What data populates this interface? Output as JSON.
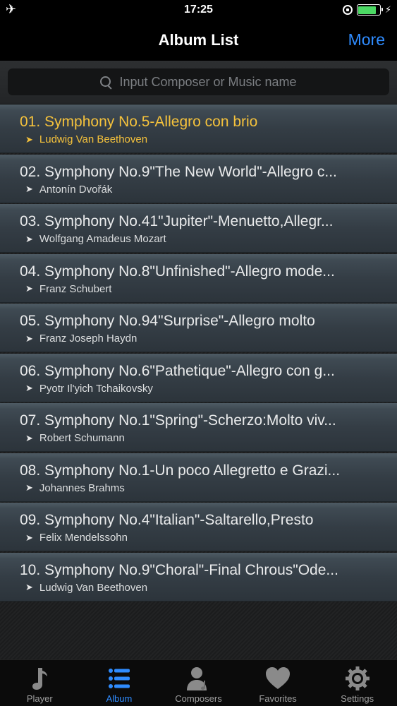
{
  "status_bar": {
    "time": "17:25",
    "battery_level": 0.85
  },
  "nav": {
    "title": "Album List",
    "more_label": "More"
  },
  "search": {
    "placeholder": "Input Composer or Music name"
  },
  "colors": {
    "accent": "#2f8cff",
    "active_row": "#f5c23c"
  },
  "list": {
    "active_index": 0,
    "items": [
      {
        "title": "01. Symphony No.5-Allegro con brio",
        "composer": "Ludwig Van Beethoven"
      },
      {
        "title": "02. Symphony No.9\"The New World\"-Allegro c...",
        "composer": "Antonín Dvořák"
      },
      {
        "title": "03. Symphony No.41\"Jupiter\"-Menuetto,Allegr...",
        "composer": "Wolfgang Amadeus Mozart"
      },
      {
        "title": "04. Symphony No.8\"Unfinished\"-Allegro mode...",
        "composer": "Franz Schubert"
      },
      {
        "title": "05. Symphony No.94\"Surprise\"-Allegro molto",
        "composer": "Franz Joseph Haydn"
      },
      {
        "title": "06. Symphony No.6\"Pathetique\"-Allegro con g...",
        "composer": "Pyotr Il'yich Tchaikovsky"
      },
      {
        "title": "07. Symphony No.1\"Spring\"-Scherzo:Molto viv...",
        "composer": "Robert Schumann"
      },
      {
        "title": "08. Symphony No.1-Un poco Allegretto e Grazi...",
        "composer": "Johannes Brahms"
      },
      {
        "title": "09. Symphony No.4\"Italian\"-Saltarello,Presto",
        "composer": "Felix Mendelssohn"
      },
      {
        "title": "10. Symphony No.9\"Choral\"-Final Chrous\"Ode...",
        "composer": "Ludwig Van Beethoven"
      }
    ]
  },
  "tabs": [
    {
      "label": "Player",
      "icon": "music-note-icon"
    },
    {
      "label": "Album",
      "icon": "list-icon"
    },
    {
      "label": "Composers",
      "icon": "composer-icon"
    },
    {
      "label": "Favorites",
      "icon": "heart-icon"
    },
    {
      "label": "Settings",
      "icon": "gear-icon"
    }
  ],
  "active_tab": 1
}
